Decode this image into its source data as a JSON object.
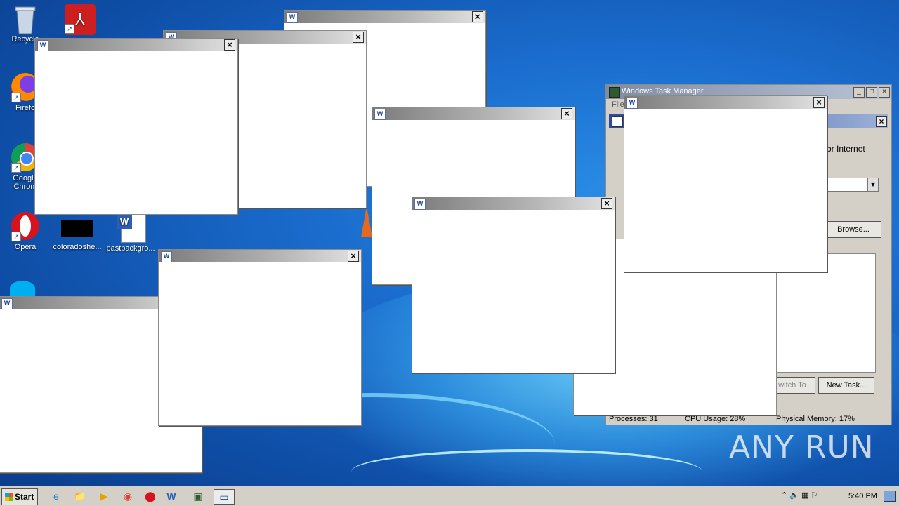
{
  "desktop": {
    "icons": [
      {
        "label": "Recycle",
        "icon": "recycle-bin-icon"
      },
      {
        "label": "",
        "icon": "adobe-pdf-icon"
      },
      {
        "label": "Firefo",
        "icon": "firefox-icon"
      },
      {
        "label": "Google Chrom",
        "icon": "chrome-icon"
      },
      {
        "label": "Opera",
        "icon": "opera-icon"
      },
      {
        "label": "coloradoshe...",
        "icon": "black-image-icon"
      },
      {
        "label": "pastbackgro...",
        "icon": "word-document-icon"
      }
    ]
  },
  "task_manager": {
    "title": "Windows Task Manager",
    "menu_file": "File",
    "dialog_text": "t, or Internet",
    "browse_label": "Browse...",
    "switch_to_label": "witch To",
    "new_task_label": "New Task...",
    "status_processes": "Processes: 31",
    "status_cpu": "CPU Usage: 28%",
    "status_memory": "Physical Memory: 17%"
  },
  "window_icon_glyph": "W",
  "close_glyph": "×",
  "taskbar": {
    "start_label": "Start",
    "clock": "5:40 PM",
    "items": [
      "ie-icon",
      "explorer-icon",
      "media-player-icon",
      "chrome-icon",
      "opera-icon",
      "word-icon",
      "task-manager-icon",
      "run-dialog-icon"
    ]
  },
  "watermark": "ANY RUN"
}
